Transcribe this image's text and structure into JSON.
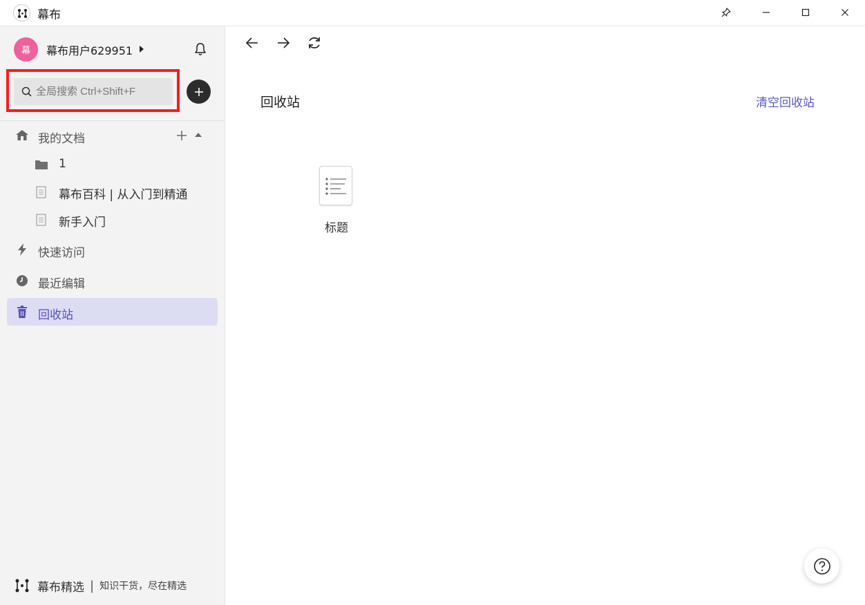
{
  "window": {
    "title": "幕布",
    "pin_icon": "pin-icon",
    "minimize_icon": "minimize-icon",
    "maximize_icon": "maximize-icon",
    "close_icon": "close-icon"
  },
  "user": {
    "avatar_text": "幕",
    "avatar_color": "#f0619c",
    "name": "幕布用户629951"
  },
  "search": {
    "placeholder": "全局搜索 Ctrl+Shift+F",
    "value": "",
    "highlight_color": "#ff1a1a"
  },
  "sidebar": {
    "my_docs": {
      "label": "我的文档",
      "items": [
        {
          "type": "folder",
          "label": "1"
        },
        {
          "type": "doc",
          "label": "幕布百科 | 从入门到精通"
        },
        {
          "type": "doc",
          "label": "新手入门"
        }
      ]
    },
    "quick_access": {
      "label": "快速访问"
    },
    "recent": {
      "label": "最近编辑"
    },
    "trash": {
      "label": "回收站",
      "active": true
    },
    "footer": {
      "brand": "幕布精选",
      "separator": "|",
      "slogan": "知识干货，尽在精选"
    }
  },
  "main": {
    "title": "回收站",
    "clear_label": "清空回收站",
    "accent_color": "#5a57c6",
    "items": [
      {
        "type": "doc",
        "label": "标题"
      }
    ],
    "help_label": "?"
  }
}
